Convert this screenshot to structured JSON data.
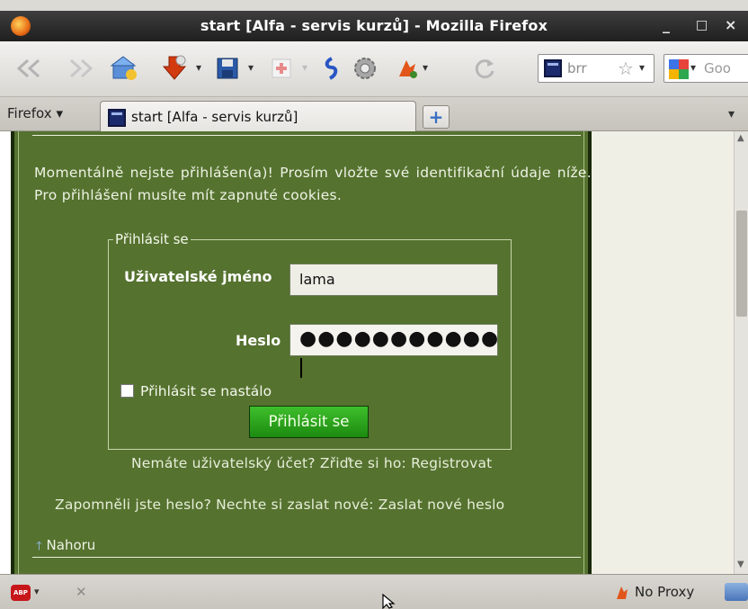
{
  "window": {
    "title": "start [Alfa - servis kurzů] - Mozilla Firefox",
    "minimize_glyph": "_",
    "maximize_glyph": "□",
    "close_glyph": "×"
  },
  "toolbar": {
    "back_glyph": "<",
    "forward_glyph": ">",
    "dropdown_glyph": "▾",
    "reload_glyph": "C",
    "url_text": "brr",
    "bookmark_star": "☆",
    "search_text": "Goo"
  },
  "tabs": {
    "firefox_menu_label": "Firefox",
    "firefox_menu_arrow": "▾",
    "active_tab_label": "start [Alfa - servis kurzů]",
    "new_tab_glyph": "+",
    "list_all_tabs_glyph": "▾"
  },
  "page": {
    "intro_text": "Momentálně nejste přihlášen(a)! Prosím vložte své identifikační údaje níže. Pro přihlášení musíte mít zapnuté cookies.",
    "login_legend": "Přihlásit se",
    "username_label": "Uživatelské jméno",
    "username_value": "lama",
    "password_label": "Heslo",
    "password_value": "●●●●●●●●●●●",
    "remember_label": "Přihlásit se nastálo",
    "submit_label": "Přihlásit se",
    "register_text": "Nemáte uživatelský účet? Zřiďte si ho: Registrovat",
    "forgot_text": "Zapomněli jste heslo? Nechte si zaslat nové: Zaslat nové heslo",
    "top_link": "Nahoru",
    "top_arrow": "🡑"
  },
  "statusbar": {
    "abp_label": "ABP",
    "proxy_label": "No Proxy",
    "close_glyph": "✕"
  }
}
